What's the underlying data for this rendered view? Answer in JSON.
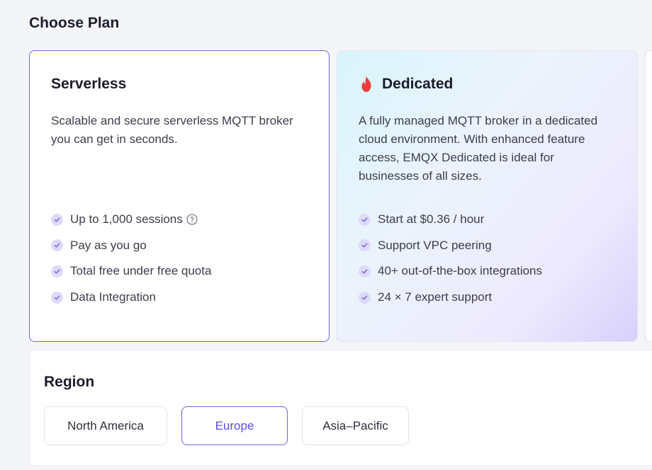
{
  "page": {
    "title": "Choose Plan"
  },
  "plans": [
    {
      "name": "Serverless",
      "description": "Scalable and secure serverless MQTT broker you can get in seconds.",
      "selected": true,
      "features": [
        "Up to 1,000 sessions",
        "Pay as you go",
        "Total free under free quota",
        "Data Integration"
      ]
    },
    {
      "name": "Dedicated",
      "icon": "flame-icon",
      "description": "A fully managed MQTT broker in a dedicated cloud environment. With enhanced feature access, EMQX Dedicated is ideal for businesses of all sizes.",
      "selected": false,
      "features": [
        "Start at $0.36 / hour",
        "Support VPC peering",
        "40+ out-of-the-box integrations",
        "24 × 7 expert support"
      ]
    }
  ],
  "region": {
    "title": "Region",
    "options": [
      "North America",
      "Europe",
      "Asia–Pacific"
    ],
    "selected": "Europe"
  },
  "colors": {
    "accent": "#6f63e6",
    "check_bg": "#dedaf9",
    "check_mark": "#6f63e6",
    "flame": "#ec3d3d"
  }
}
